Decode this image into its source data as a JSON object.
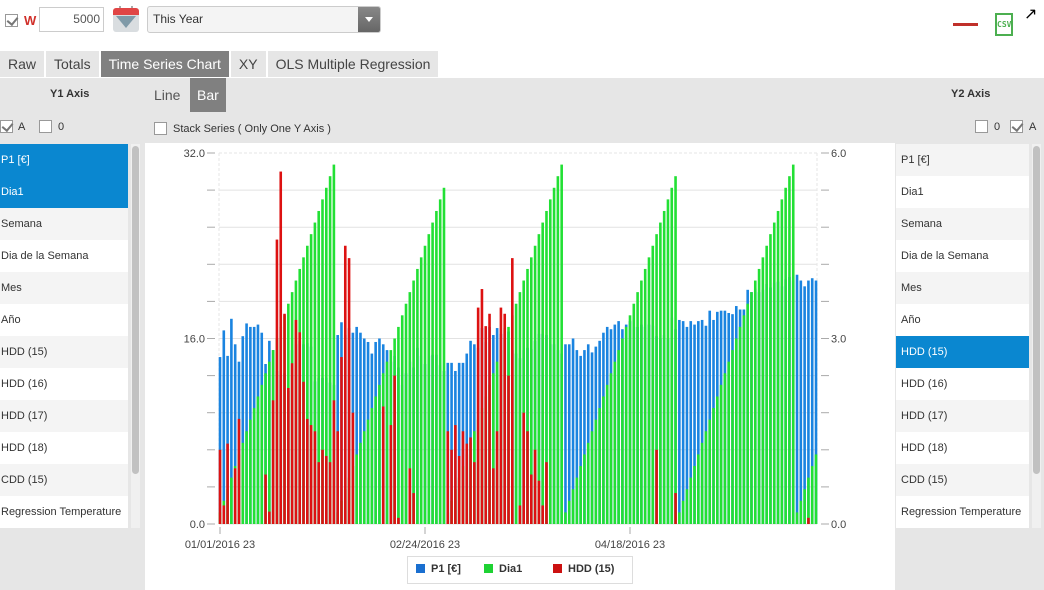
{
  "toolbar": {
    "w_checked": true,
    "w_label": "W",
    "w_value": "5000",
    "calendar_icon": "calendar-icon",
    "period_select": "This Year",
    "line_color_indicator": "#c0302a",
    "csv_label": "CSV",
    "expand_icon": "expand-arrow-icon"
  },
  "tabs": [
    {
      "label": "Raw",
      "active": false
    },
    {
      "label": "Totals",
      "active": false
    },
    {
      "label": "Time Series Chart",
      "active": true
    },
    {
      "label": "XY",
      "active": false
    },
    {
      "label": "OLS Multiple Regression",
      "active": false
    }
  ],
  "chart_mode": {
    "line_label": "Line",
    "bar_label": "Bar",
    "active": "Bar",
    "stack_series_label": "Stack Series ( Only One Y Axis )",
    "stack_series_checked": false
  },
  "y1_panel": {
    "title": "Y1 Axis",
    "auto_label": "A",
    "auto_checked": true,
    "zero_label": "0",
    "zero_checked": false,
    "items": [
      {
        "label": "P1 [€]",
        "selected": true
      },
      {
        "label": "Dia1",
        "selected": true
      },
      {
        "label": "Semana",
        "selected": false
      },
      {
        "label": "Dia de la Semana",
        "selected": false
      },
      {
        "label": "Mes",
        "selected": false
      },
      {
        "label": "Año",
        "selected": false
      },
      {
        "label": "HDD (15)",
        "selected": false
      },
      {
        "label": "HDD (16)",
        "selected": false
      },
      {
        "label": "HDD (17)",
        "selected": false
      },
      {
        "label": "HDD (18)",
        "selected": false
      },
      {
        "label": "CDD (15)",
        "selected": false
      },
      {
        "label": "Regression Temperature",
        "selected": false
      }
    ]
  },
  "y2_panel": {
    "title": "Y2 Axis",
    "zero_label": "0",
    "zero_checked": false,
    "auto_label": "A",
    "auto_checked": true,
    "items": [
      {
        "label": "P1 [€]",
        "selected": false
      },
      {
        "label": "Dia1",
        "selected": false
      },
      {
        "label": "Semana",
        "selected": false
      },
      {
        "label": "Dia de la Semana",
        "selected": false
      },
      {
        "label": "Mes",
        "selected": false
      },
      {
        "label": "Año",
        "selected": false
      },
      {
        "label": "HDD (15)",
        "selected": true
      },
      {
        "label": "HDD (16)",
        "selected": false
      },
      {
        "label": "HDD (17)",
        "selected": false
      },
      {
        "label": "HDD (18)",
        "selected": false
      },
      {
        "label": "CDD (15)",
        "selected": false
      },
      {
        "label": "Regression Temperature",
        "selected": false
      }
    ]
  },
  "chart_data": {
    "type": "bar",
    "title": "",
    "xlabel": "",
    "x_start": "01/01/2016",
    "x_count_days": 158,
    "x_tick_labels": [
      "01/01/2016 23",
      "02/24/2016 23",
      "04/18/2016 23"
    ],
    "x_tick_day_index": [
      0,
      54,
      108
    ],
    "y1": {
      "ylim": [
        0,
        32
      ],
      "tick_labels": [
        "0.0",
        "16.0",
        "32.0"
      ],
      "minor_step": 3.2
    },
    "y2": {
      "ylim": [
        0,
        6
      ],
      "tick_labels": [
        "0.0",
        "3.0",
        "6.0"
      ],
      "minor_step": 0.6
    },
    "grid": true,
    "legend_position": "bottom-center",
    "series": [
      {
        "name": "P1 [€]",
        "axis": "y1",
        "color": "#1a84e0",
        "values": [
          14.4,
          16.7,
          14.5,
          17.7,
          15.5,
          14.0,
          16.2,
          17.3,
          17.0,
          17.0,
          17.2,
          16.5,
          13.8,
          15.8,
          15.0,
          13.2,
          12.8,
          13.0,
          11.5,
          15.0,
          15.5,
          15.8,
          15.5,
          15.6,
          15.3,
          12.3,
          12.6,
          12.6,
          12.6,
          12.2,
          12.0,
          16.3,
          17.4,
          16.3,
          16.9,
          16.5,
          17.0,
          16.5,
          16.0,
          15.7,
          14.7,
          15.7,
          16.0,
          15.5,
          15.0,
          14.0,
          14.5,
          13.5,
          12.0,
          13.0,
          14.0,
          13.5,
          15.2,
          14.5,
          13.8,
          14.5,
          14.6,
          14.6,
          13.7,
          13.2,
          13.9,
          13.9,
          13.2,
          13.9,
          13.9,
          14.7,
          15.8,
          15.5,
          15.2,
          16.9,
          15.7,
          17.0,
          16.3,
          16.9,
          16.4,
          16.9,
          16.6,
          15.0,
          14.7,
          14.3,
          15.0,
          15.2,
          15.1,
          15.8,
          16.4,
          16.4,
          16.3,
          15.5,
          15.5,
          15.0,
          14.7,
          15.5,
          15.5,
          16.0,
          15.0,
          14.5,
          15.0,
          15.5,
          14.8,
          15.3,
          15.8,
          16.5,
          17.0,
          16.8,
          17.2,
          17.5,
          16.8,
          17.2,
          17.5,
          17.0,
          17.0,
          17.2,
          17.0,
          17.2,
          17.1,
          16.2,
          16.0,
          16.3,
          16.0,
          17.8,
          16.8,
          17.6,
          17.5,
          17.0,
          17.5,
          17.2,
          17.5,
          17.6,
          17.1,
          18.4,
          17.6,
          18.3,
          18.4,
          18.4,
          18.2,
          18.1,
          18.8,
          18.5,
          18.5,
          20.2,
          20.0,
          20.3,
          20.0,
          20.2,
          20.7,
          20.4,
          20.8,
          20.9,
          20.5,
          21.1,
          21.3,
          21.0,
          21.5,
          21.0,
          20.5,
          21.0,
          21.2,
          21.0
        ]
      },
      {
        "name": "Dia1",
        "axis": "y1",
        "color": "#22e034",
        "values": [
          1,
          2,
          3,
          4,
          5,
          6,
          7,
          8,
          9,
          10,
          11,
          12,
          13,
          14,
          15,
          16,
          17,
          18,
          19,
          20,
          21,
          22,
          23,
          24,
          25,
          26,
          27,
          28,
          29,
          30,
          31,
          1,
          2,
          3,
          4,
          5,
          6,
          7,
          8,
          9,
          10,
          11,
          12,
          13,
          14,
          15,
          16,
          17,
          18,
          19,
          20,
          21,
          22,
          23,
          24,
          25,
          26,
          27,
          28,
          29,
          1,
          2,
          3,
          4,
          5,
          6,
          7,
          8,
          9,
          10,
          11,
          12,
          13,
          14,
          15,
          16,
          17,
          18,
          19,
          20,
          21,
          22,
          23,
          24,
          25,
          26,
          27,
          28,
          29,
          30,
          31,
          1,
          2,
          3,
          4,
          5,
          6,
          7,
          8,
          9,
          10,
          11,
          12,
          13,
          14,
          15,
          16,
          17,
          18,
          19,
          20,
          21,
          22,
          23,
          24,
          25,
          26,
          27,
          28,
          29,
          30,
          1,
          2,
          3,
          4,
          5,
          6,
          7,
          8,
          9,
          10,
          11,
          12,
          13,
          14,
          15,
          16,
          17,
          18,
          19,
          20,
          21,
          22,
          23,
          24,
          25,
          26,
          27,
          28,
          29,
          30,
          31,
          1,
          2,
          3,
          4,
          5,
          6
        ]
      },
      {
        "name": "HDD (15)",
        "axis": "y2",
        "color": "#dd1111",
        "values": [
          1.2,
          0.3,
          1.3,
          0.0,
          0.9,
          1.7,
          0.0,
          0.0,
          0.0,
          0.0,
          0.0,
          0.0,
          0.8,
          0.2,
          2.0,
          4.6,
          5.7,
          3.4,
          2.2,
          2.6,
          3.3,
          3.1,
          2.3,
          1.7,
          1.6,
          1.5,
          1.0,
          1.2,
          1.1,
          1.0,
          2.0,
          1.5,
          2.7,
          4.5,
          4.3,
          1.8,
          0.0,
          0.0,
          0.0,
          0.0,
          0.0,
          0.0,
          0.0,
          1.9,
          0.0,
          1.6,
          2.4,
          0.1,
          0.0,
          0.0,
          0.9,
          0.5,
          0.0,
          0.0,
          0.0,
          0.0,
          0.0,
          0.0,
          0.0,
          0.0,
          1.5,
          1.2,
          1.6,
          1.1,
          1.5,
          1.3,
          1.4,
          1.0,
          3.5,
          3.8,
          3.2,
          3.4,
          0.9,
          1.5,
          3.5,
          3.4,
          2.4,
          4.3,
          0.0,
          0.3,
          1.8,
          1.5,
          0.8,
          1.2,
          0.7,
          0.3,
          1.0,
          0.0,
          0.0,
          0.0,
          0.0,
          0.0,
          0.0,
          0.0,
          0.0,
          0.0,
          0.0,
          0.0,
          0.0,
          0.0,
          0.0,
          0.0,
          0.0,
          0.0,
          0.0,
          0.0,
          0.0,
          0.0,
          0.0,
          0.0,
          0.0,
          0.0,
          0.0,
          0.0,
          0.0,
          1.2,
          0.0,
          0.0,
          0.0,
          0.0,
          0.5,
          0.0,
          0.0,
          0.0,
          0.0,
          0.0,
          0.0,
          0.0,
          0.0,
          0.0,
          0.0,
          0.0,
          0.0,
          0.0,
          0.0,
          0.0,
          0.0,
          0.0,
          0.0,
          0.0,
          0.0,
          0.0,
          0.0,
          0.0,
          0.0,
          0.0,
          0.0,
          0.0,
          0.0,
          0.0,
          0.0,
          0.0,
          0.0,
          0.0,
          0.0,
          0.1,
          0.0,
          0.0,
          0.0,
          0.0,
          0.0,
          0.0,
          0.0
        ]
      }
    ]
  }
}
